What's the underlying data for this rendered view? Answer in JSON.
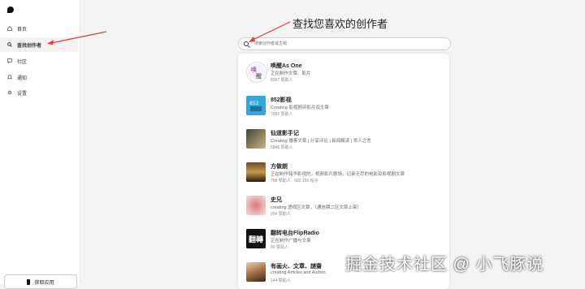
{
  "sidebar": {
    "items": [
      {
        "label": "首页",
        "icon": "home-icon",
        "active": false
      },
      {
        "label": "查找创作者",
        "icon": "search-icon",
        "active": true
      },
      {
        "label": "社区",
        "icon": "chat-icon",
        "active": false
      },
      {
        "label": "通知",
        "icon": "bell-icon",
        "active": false
      },
      {
        "label": "设置",
        "icon": "gear-icon",
        "active": false
      }
    ],
    "get_app_label": "获取应用"
  },
  "main": {
    "title": "查找您喜欢的创作者",
    "search_placeholder": "搜索创作者或主题"
  },
  "creators": [
    {
      "name": "唤醒As One",
      "desc": "正在制作文章、影片",
      "patrons": "8397 赞助人"
    },
    {
      "name": "852影视",
      "desc": "Creating 影视剧评影片及文章",
      "patrons": "7092 赞助人"
    },
    {
      "name": "仙道影手记",
      "desc": "Creating 播客文章 | 分享评论 | 新闻解读 | 世人之言",
      "patrons": "5846 赞助人"
    },
    {
      "name": "方做朗",
      "desc": "正在制作铭华影视的，视频影片剧场，记录无尽的电影及影视剧文章",
      "patrons": "758 赞助人 · 682 150 帖子"
    },
    {
      "name": "史兄",
      "desc": "creating 透视区文章，（通信期二区文章上架）",
      "patrons": "204 赞助人"
    },
    {
      "name": "翻转电台FlipRadio",
      "desc": "正在制作广播与文章",
      "patrons": "80 赞助人"
    },
    {
      "name": "有画火、文章、謎齋",
      "desc": "creating Articles and Audios",
      "patrons": "144 赞助人"
    }
  ],
  "watermark": "掘金技术社区 @ 小飞豚说",
  "colors": {
    "accent_arrow": "#e53935",
    "background": "#f4f4f4"
  }
}
